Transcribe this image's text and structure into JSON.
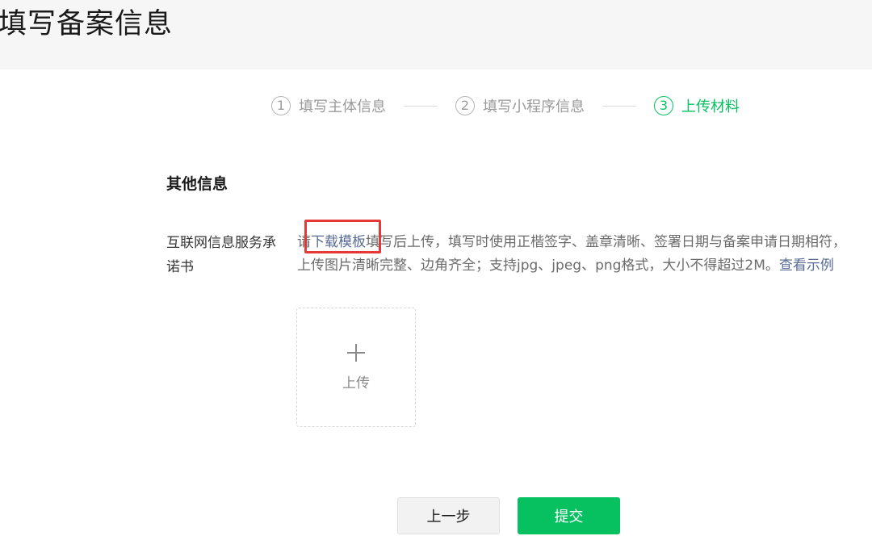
{
  "header": {
    "title": "填写备案信息"
  },
  "steps": [
    {
      "num": "1",
      "label": "填写主体信息",
      "active": false
    },
    {
      "num": "2",
      "label": "填写小程序信息",
      "active": false
    },
    {
      "num": "3",
      "label": "上传材料",
      "active": true
    }
  ],
  "section": {
    "title": "其他信息"
  },
  "field": {
    "label": "互联网信息服务承诺书",
    "desc_prefix": "请",
    "download_link": "下载模板",
    "desc_middle": "填写后上传，填写时使用正楷签字、盖章清晰、签署日期与备案申请日期相符，上传图片清晰完整、边角齐全；支持jpg、jpeg、png格式，大小不得超过2M。",
    "example_link": "查看示例"
  },
  "upload": {
    "label": "上传"
  },
  "buttons": {
    "prev": "上一步",
    "submit": "提交"
  },
  "colors": {
    "accent": "#07c160",
    "link": "#576b95",
    "highlight": "#e53935"
  }
}
